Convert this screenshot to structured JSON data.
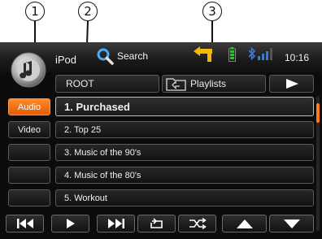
{
  "callouts": [
    "1",
    "2",
    "3"
  ],
  "header": {
    "app_title": "iPod",
    "search_label": "Search",
    "clock": "10:16"
  },
  "breadcrumb": {
    "root_label": "ROOT",
    "current_label": "Playlists"
  },
  "sidebar": {
    "tabs": [
      {
        "label": "Audio",
        "active": true
      },
      {
        "label": "Video",
        "active": false
      },
      {
        "label": "",
        "active": false
      },
      {
        "label": "",
        "active": false
      },
      {
        "label": "",
        "active": false
      }
    ]
  },
  "playlist": {
    "items": [
      {
        "label": "1. Purchased",
        "selected": true
      },
      {
        "label": "2. Top 25",
        "selected": false
      },
      {
        "label": "3. Music of the 90's",
        "selected": false
      },
      {
        "label": "4. Music of the 80's",
        "selected": false
      },
      {
        "label": "5. Workout",
        "selected": false
      }
    ]
  },
  "controls": [
    "skip-back-icon",
    "play-icon",
    "skip-forward-icon",
    "repeat-icon",
    "shuffle-icon",
    "page-up-icon",
    "page-down-icon"
  ],
  "colors": {
    "accent": "#f07010",
    "background": "#0c0c0c",
    "status_arrow": "#f5b800",
    "battery": "#2fbf2f",
    "bluetooth": "#3a7bd5"
  }
}
